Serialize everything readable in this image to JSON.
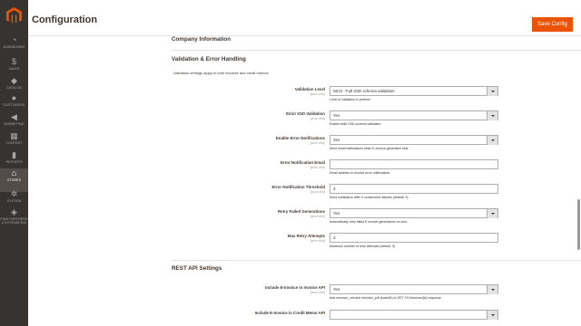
{
  "page": {
    "title": "Configuration",
    "save_label": "Save Config"
  },
  "sidebar": {
    "items": [
      {
        "label": "DASHBOARD",
        "icon": "speedometer-icon"
      },
      {
        "label": "SALES",
        "icon": "dollar-icon"
      },
      {
        "label": "CATALOG",
        "icon": "cube-icon"
      },
      {
        "label": "CUSTOMERS",
        "icon": "person-icon"
      },
      {
        "label": "MARKETING",
        "icon": "megaphone-icon"
      },
      {
        "label": "CONTENT",
        "icon": "layout-icon"
      },
      {
        "label": "REPORTS",
        "icon": "bar-chart-icon"
      },
      {
        "label": "STORES",
        "icon": "store-icon"
      },
      {
        "label": "SYSTEM",
        "icon": "gear-icon"
      },
      {
        "label": "FIND PARTNERS & EXTENSIONS",
        "icon": "puzzle-icon"
      }
    ]
  },
  "sections": {
    "company": {
      "title": "Company Information"
    },
    "validation": {
      "title": "Validation & Error Handling",
      "description": "Validation settings apply to both invoices and credit memos"
    },
    "rest": {
      "title": "REST API Settings"
    }
  },
  "scope_label": "[store view]",
  "rows": [
    {
      "label": "Validation Level",
      "value": "Strict - Full XSD schema validation",
      "note": "Level of validation to perform"
    },
    {
      "label": "Strict XSD Validation",
      "value": "Yes",
      "note": "Enable strict XSD schema validation"
    },
    {
      "label": "Enable Error Notifications",
      "value": "Yes",
      "note": "Send email notifications when E-invoice generation fails"
    },
    {
      "label": "Error Notification Email",
      "value": "",
      "note": "Email address to receive error notifications"
    },
    {
      "label": "Error Notification Threshold",
      "value": "3",
      "note": "Send notification after X consecutive failures (default: 3)"
    },
    {
      "label": "Retry Failed Generations",
      "value": "Yes",
      "note": "Automatically retry failed E-invoice generations on cron"
    },
    {
      "label": "Max Retry Attempts",
      "value": "3",
      "note": "Maximum number of retry attempts (default: 3)"
    },
    {
      "label": "Include E-Invoice in Invoice API",
      "value": "Yes",
      "note": "Add einvoice_xml and einvoice_pdf (base64) to GET /V1/invoices/{id} response"
    },
    {
      "label": "Include E-Invoice in Credit Memo API",
      "value": "",
      "note": ""
    }
  ],
  "colors": {
    "accent": "#eb5202",
    "sidebar": "#373330",
    "active": "#524d49"
  }
}
